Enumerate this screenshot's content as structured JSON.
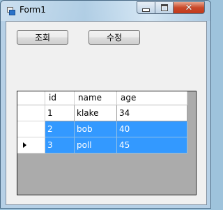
{
  "window": {
    "title": "Form1"
  },
  "buttons": {
    "query": "조회",
    "edit": "수정"
  },
  "grid": {
    "columns": [
      "id",
      "name",
      "age"
    ],
    "rows": [
      {
        "id": "1",
        "name": "klake",
        "age": "34",
        "selected": false
      },
      {
        "id": "2",
        "name": "bob",
        "age": "40",
        "selected": true
      },
      {
        "id": "3",
        "name": "poll",
        "age": "45",
        "selected": true
      }
    ],
    "current_row_index": 2
  },
  "colors": {
    "selection": "#3399ff",
    "grid_background": "#ababab",
    "close_button": "#c9482a"
  }
}
